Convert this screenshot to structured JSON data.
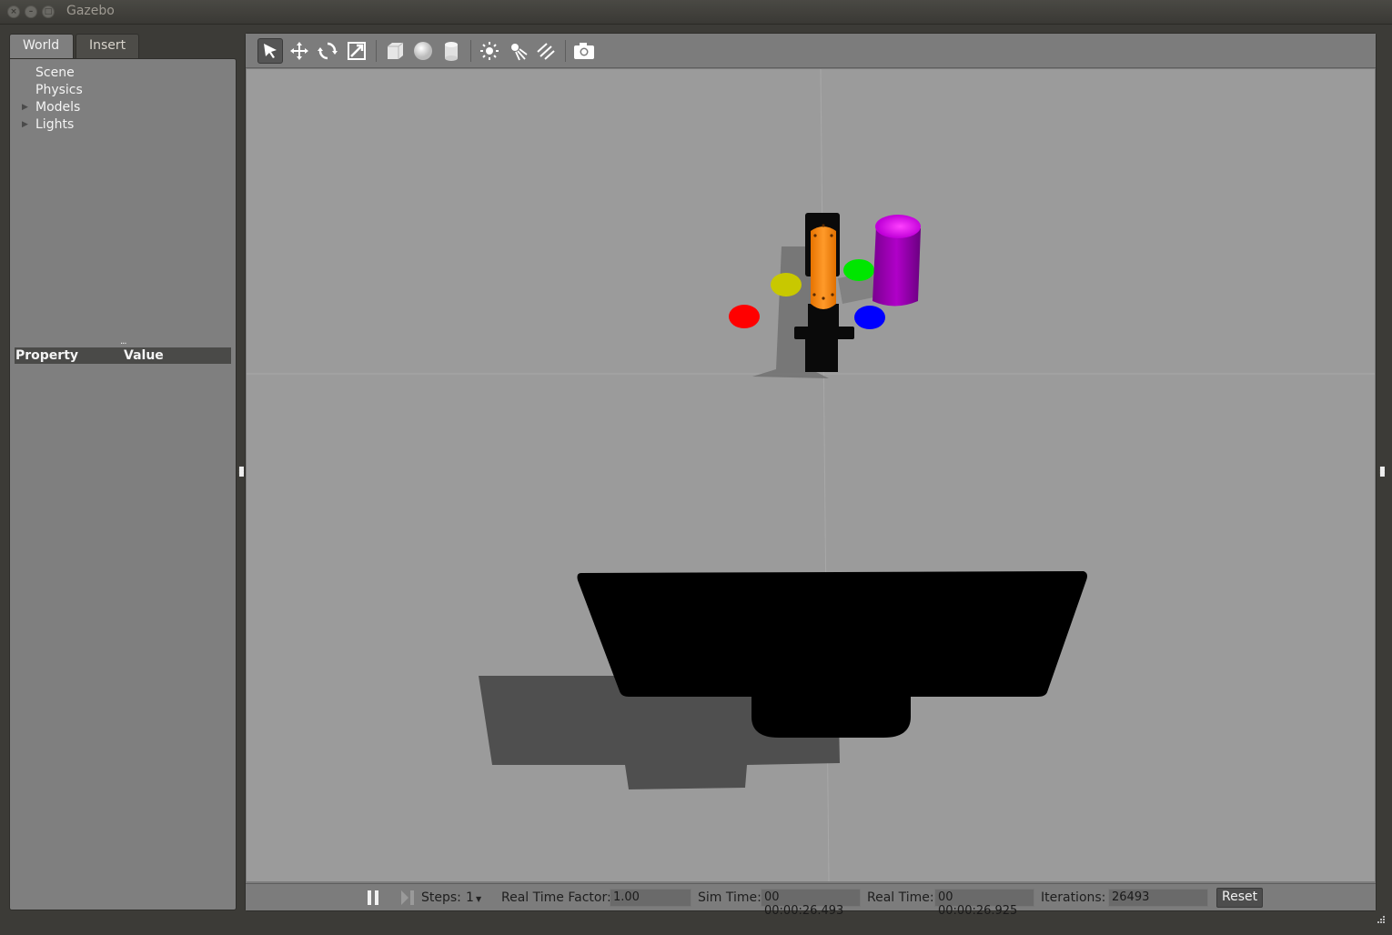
{
  "window": {
    "title": "Gazebo",
    "buttons": {
      "close": "×",
      "minimize": "–",
      "maximize": "□"
    }
  },
  "left_panel": {
    "tabs": [
      {
        "label": "World",
        "active": true
      },
      {
        "label": "Insert",
        "active": false
      }
    ],
    "tree": [
      {
        "label": "Scene",
        "expandable": false
      },
      {
        "label": "Physics",
        "expandable": false
      },
      {
        "label": "Models",
        "expandable": true
      },
      {
        "label": "Lights",
        "expandable": true
      }
    ],
    "property_table": {
      "col_property": "Property",
      "col_value": "Value"
    }
  },
  "toolbar": {
    "tools": [
      {
        "name": "select-mode",
        "icon": "arrow-cursor-icon",
        "active": true
      },
      {
        "name": "translate-mode",
        "icon": "move-arrows-icon"
      },
      {
        "name": "rotate-mode",
        "icon": "rotate-icon"
      },
      {
        "name": "scale-mode",
        "icon": "scale-icon"
      },
      {
        "name": "box-shape",
        "icon": "box-icon"
      },
      {
        "name": "sphere-shape",
        "icon": "sphere-icon"
      },
      {
        "name": "cylinder-shape",
        "icon": "cylinder-icon"
      },
      {
        "name": "point-light",
        "icon": "point-light-icon"
      },
      {
        "name": "spot-light",
        "icon": "spot-light-icon"
      },
      {
        "name": "directional-light",
        "icon": "directional-light-icon"
      },
      {
        "name": "screenshot",
        "icon": "camera-icon"
      }
    ]
  },
  "scene": {
    "background": "#9b9b9b",
    "objects": {
      "red_marker": "#ff0000",
      "yellow_marker": "#c8c800",
      "green_marker": "#00e600",
      "blue_marker": "#0000ff",
      "purple_cylinder": "#b000c8",
      "orange_arm": "#ff8c1a"
    }
  },
  "bottom_bar": {
    "pause_icon": "pause-icon",
    "step_icon": "step-icon",
    "steps_label": "Steps:",
    "steps_value": "1",
    "rtf_label": "Real Time Factor:",
    "rtf_value": "1.00",
    "sim_time_label": "Sim Time:",
    "sim_time_value": "00 00:00:26.493",
    "real_time_label": "Real Time:",
    "real_time_value": "00 00:00:26.925",
    "iterations_label": "Iterations:",
    "iterations_value": "26493",
    "reset_label": "Reset"
  }
}
